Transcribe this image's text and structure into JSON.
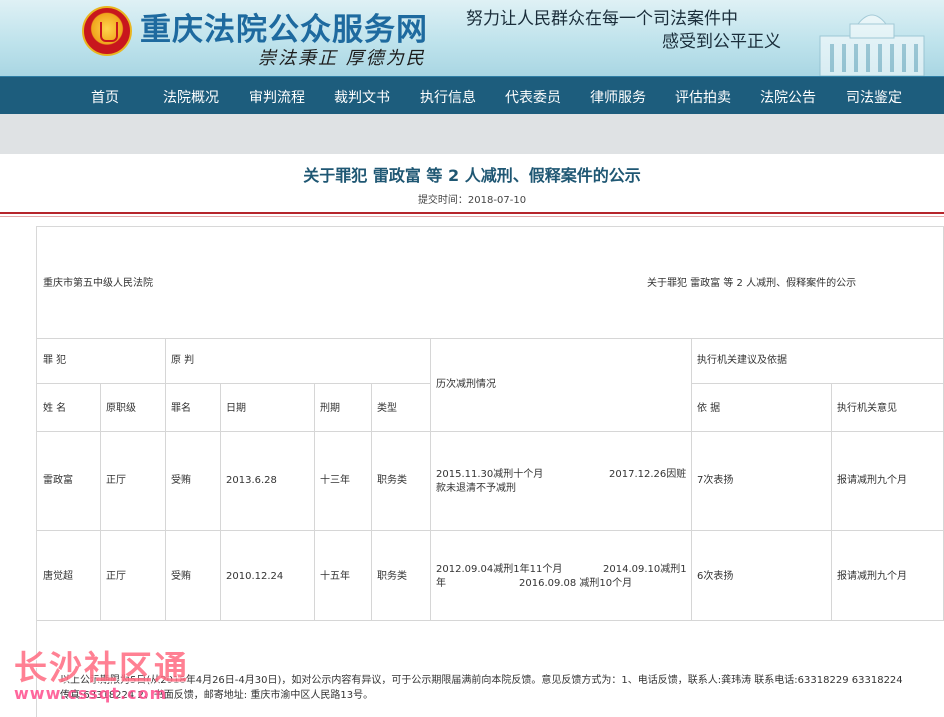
{
  "header": {
    "site_title": "重庆法院公众服务网",
    "motto": "崇法秉正 厚德为民",
    "slogan_line1": "努力让人民群众在每一个司法案件中",
    "slogan_line2": "感受到公平正义"
  },
  "nav": {
    "items": [
      "首页",
      "法院概况",
      "审判流程",
      "裁判文书",
      "执行信息",
      "代表委员",
      "律师服务",
      "评估拍卖",
      "法院公告",
      "司法鉴定"
    ]
  },
  "document": {
    "title": "关于罪犯 雷政富 等 2 人减刑、假释案件的公示",
    "submit_time": "提交时间：2018-07-10"
  },
  "notice_table": {
    "court": "重庆市第五中级人民法院",
    "notice_title": "关于罪犯 雷政富 等 2 人减刑、假释案件的公示",
    "group_headers": {
      "criminal": "罪 犯",
      "original": "原 判",
      "history": "历次减刑情况",
      "agency": "执行机关建议及依据"
    },
    "columns": {
      "name": "姓 名",
      "former_rank": "原职级",
      "crime": "罪名",
      "date": "日期",
      "term": "刑期",
      "type": "类型",
      "basis": "依 据",
      "opinion": "执行机关意见"
    },
    "rows": [
      {
        "name": "雷政富",
        "rank": "正厅",
        "crime": "受贿",
        "date": "2013.6.28",
        "term": "十三年",
        "type": "职务类",
        "history_a": "2015.11.30减刑十个月",
        "history_b": "2017.12.26因赃",
        "history_c": "款未退清不予减刑",
        "basis": "7次表扬",
        "opinion": "报请减刑九个月"
      },
      {
        "name": "唐觉超",
        "rank": "正厅",
        "crime": "受贿",
        "date": "2010.12.24",
        "term": "十五年",
        "type": "职务类",
        "history_a": "2012.09.04减刑1年11个月",
        "history_b": "2014.09.10减刑1",
        "history_c": "年",
        "history_d": "2016.09.08 减刑10个月",
        "basis": "6次表扬",
        "opinion": "报请减刑九个月"
      }
    ],
    "footer_line1": "以上公示期限为5日(从2018年4月26日-4月30日)，如对公示内容有异议，可于公示期限届满前向本院反馈。意见反馈方式为：1、电话反馈，联系人:龚玮涛  联系电话:63318229     63318224",
    "footer_line2": "传真:63318224 2、书面反馈，邮寄地址: 重庆市渝中区人民路13号。"
  },
  "watermark": {
    "text": "长沙社区通",
    "url": "www.cssqt.com"
  }
}
